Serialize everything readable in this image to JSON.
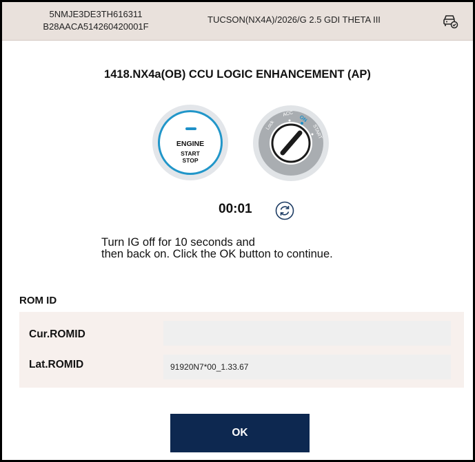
{
  "header": {
    "vin_line1": "5NMJE3DE3TH616311",
    "vin_line2": "B28AACA514260420001F",
    "vehicle_model": "TUCSON(NX4A)/2026/G 2.5 GDI THETA III",
    "vehicle_icon": "vehicle-check-icon"
  },
  "procedure": {
    "title": "1418.NX4a(OB) CCU LOGIC ENHANCEMENT (AP)",
    "engine_button": {
      "line1": "ENGINE",
      "line2": "START",
      "line3": "STOP"
    },
    "key_positions": [
      "Lock",
      "ACC",
      "ON",
      "START"
    ],
    "timer": "00:01",
    "refresh_icon": "refresh-icon",
    "instruction_line1": "Turn IG off for 10 seconds and",
    "instruction_line2": "then back on. Click the OK button to continue."
  },
  "rom": {
    "heading": "ROM ID",
    "rows": [
      {
        "label": "Cur.ROMID",
        "value": ""
      },
      {
        "label": "Lat.ROMID",
        "value": "91920N7*00_1.33.67"
      }
    ]
  },
  "actions": {
    "ok_label": "OK"
  },
  "colors": {
    "header_bg": "#e9e1dc",
    "accent_blue": "#2196c9",
    "ok_button_bg": "#0d2850",
    "panel_bg": "#f7f0ed"
  }
}
